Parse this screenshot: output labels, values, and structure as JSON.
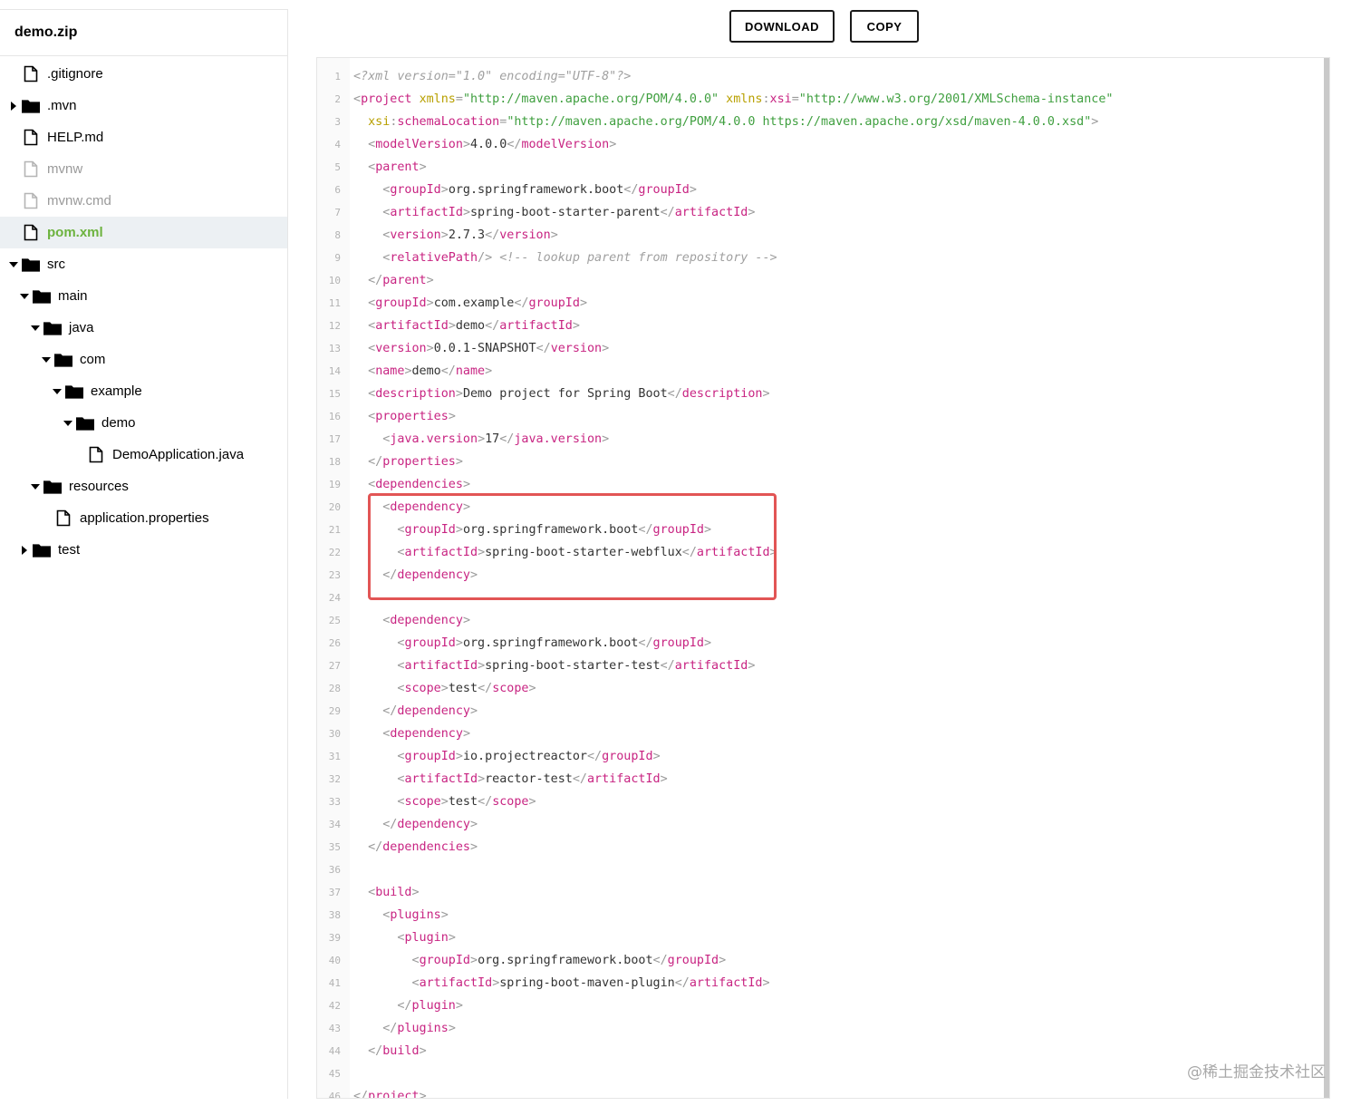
{
  "archive_name": "demo.zip",
  "buttons": {
    "download": "DOWNLOAD",
    "copy": "COPY"
  },
  "tree": [
    {
      "label": ".gitignore",
      "type": "file",
      "depth": 0,
      "caret": "none",
      "muted": false,
      "selected": false
    },
    {
      "label": ".mvn",
      "type": "folder",
      "depth": 0,
      "caret": "right",
      "muted": false,
      "selected": false
    },
    {
      "label": "HELP.md",
      "type": "file",
      "depth": 0,
      "caret": "none",
      "muted": false,
      "selected": false
    },
    {
      "label": "mvnw",
      "type": "file",
      "depth": 0,
      "caret": "none",
      "muted": true,
      "selected": false
    },
    {
      "label": "mvnw.cmd",
      "type": "file",
      "depth": 0,
      "caret": "none",
      "muted": true,
      "selected": false
    },
    {
      "label": "pom.xml",
      "type": "file",
      "depth": 0,
      "caret": "none",
      "muted": false,
      "selected": true
    },
    {
      "label": "src",
      "type": "folder",
      "depth": 0,
      "caret": "down",
      "muted": false,
      "selected": false
    },
    {
      "label": "main",
      "type": "folder",
      "depth": 1,
      "caret": "down",
      "muted": false,
      "selected": false
    },
    {
      "label": "java",
      "type": "folder",
      "depth": 2,
      "caret": "down",
      "muted": false,
      "selected": false
    },
    {
      "label": "com",
      "type": "folder",
      "depth": 3,
      "caret": "down",
      "muted": false,
      "selected": false
    },
    {
      "label": "example",
      "type": "folder",
      "depth": 4,
      "caret": "down",
      "muted": false,
      "selected": false
    },
    {
      "label": "demo",
      "type": "folder",
      "depth": 5,
      "caret": "down",
      "muted": false,
      "selected": false
    },
    {
      "label": "DemoApplication.java",
      "type": "file",
      "depth": 6,
      "caret": "none",
      "muted": false,
      "selected": false
    },
    {
      "label": "resources",
      "type": "folder",
      "depth": 2,
      "caret": "down",
      "muted": false,
      "selected": false
    },
    {
      "label": "application.properties",
      "type": "file",
      "depth": 3,
      "caret": "none",
      "muted": false,
      "selected": false
    },
    {
      "label": "test",
      "type": "folder",
      "depth": 1,
      "caret": "right",
      "muted": false,
      "selected": false
    }
  ],
  "code_lines": [
    [
      [
        "com",
        "<?xml version=\"1.0\" encoding=\"UTF-8\"?>"
      ]
    ],
    [
      [
        "punc",
        "<"
      ],
      [
        "tag",
        "project"
      ],
      [
        "text",
        " "
      ],
      [
        "attr",
        "xmlns"
      ],
      [
        "punc",
        "="
      ],
      [
        "str",
        "\"http://maven.apache.org/POM/4.0.0\""
      ],
      [
        "text",
        " "
      ],
      [
        "attr",
        "xmlns"
      ],
      [
        "punc",
        ":"
      ],
      [
        "tag",
        "xsi"
      ],
      [
        "punc",
        "="
      ],
      [
        "str",
        "\"http://www.w3.org/2001/XMLSchema-instance\""
      ]
    ],
    [
      [
        "text",
        "  "
      ],
      [
        "attr",
        "xsi"
      ],
      [
        "punc",
        ":"
      ],
      [
        "tag",
        "schemaLocation"
      ],
      [
        "punc",
        "="
      ],
      [
        "str",
        "\"http://maven.apache.org/POM/4.0.0 https://maven.apache.org/xsd/maven-4.0.0.xsd\""
      ],
      [
        "punc",
        ">"
      ]
    ],
    [
      [
        "text",
        "  "
      ],
      [
        "punc",
        "<"
      ],
      [
        "tag",
        "modelVersion"
      ],
      [
        "punc",
        ">"
      ],
      [
        "text",
        "4.0.0"
      ],
      [
        "punc",
        "</"
      ],
      [
        "tag",
        "modelVersion"
      ],
      [
        "punc",
        ">"
      ]
    ],
    [
      [
        "text",
        "  "
      ],
      [
        "punc",
        "<"
      ],
      [
        "tag",
        "parent"
      ],
      [
        "punc",
        ">"
      ]
    ],
    [
      [
        "text",
        "    "
      ],
      [
        "punc",
        "<"
      ],
      [
        "tag",
        "groupId"
      ],
      [
        "punc",
        ">"
      ],
      [
        "text",
        "org.springframework.boot"
      ],
      [
        "punc",
        "</"
      ],
      [
        "tag",
        "groupId"
      ],
      [
        "punc",
        ">"
      ]
    ],
    [
      [
        "text",
        "    "
      ],
      [
        "punc",
        "<"
      ],
      [
        "tag",
        "artifactId"
      ],
      [
        "punc",
        ">"
      ],
      [
        "text",
        "spring-boot-starter-parent"
      ],
      [
        "punc",
        "</"
      ],
      [
        "tag",
        "artifactId"
      ],
      [
        "punc",
        ">"
      ]
    ],
    [
      [
        "text",
        "    "
      ],
      [
        "punc",
        "<"
      ],
      [
        "tag",
        "version"
      ],
      [
        "punc",
        ">"
      ],
      [
        "text",
        "2.7.3"
      ],
      [
        "punc",
        "</"
      ],
      [
        "tag",
        "version"
      ],
      [
        "punc",
        ">"
      ]
    ],
    [
      [
        "text",
        "    "
      ],
      [
        "punc",
        "<"
      ],
      [
        "tag",
        "relativePath"
      ],
      [
        "punc",
        "/>"
      ],
      [
        "text",
        " "
      ],
      [
        "com",
        "<!-- lookup parent from repository -->"
      ]
    ],
    [
      [
        "text",
        "  "
      ],
      [
        "punc",
        "</"
      ],
      [
        "tag",
        "parent"
      ],
      [
        "punc",
        ">"
      ]
    ],
    [
      [
        "text",
        "  "
      ],
      [
        "punc",
        "<"
      ],
      [
        "tag",
        "groupId"
      ],
      [
        "punc",
        ">"
      ],
      [
        "text",
        "com.example"
      ],
      [
        "punc",
        "</"
      ],
      [
        "tag",
        "groupId"
      ],
      [
        "punc",
        ">"
      ]
    ],
    [
      [
        "text",
        "  "
      ],
      [
        "punc",
        "<"
      ],
      [
        "tag",
        "artifactId"
      ],
      [
        "punc",
        ">"
      ],
      [
        "text",
        "demo"
      ],
      [
        "punc",
        "</"
      ],
      [
        "tag",
        "artifactId"
      ],
      [
        "punc",
        ">"
      ]
    ],
    [
      [
        "text",
        "  "
      ],
      [
        "punc",
        "<"
      ],
      [
        "tag",
        "version"
      ],
      [
        "punc",
        ">"
      ],
      [
        "text",
        "0.0.1-SNAPSHOT"
      ],
      [
        "punc",
        "</"
      ],
      [
        "tag",
        "version"
      ],
      [
        "punc",
        ">"
      ]
    ],
    [
      [
        "text",
        "  "
      ],
      [
        "punc",
        "<"
      ],
      [
        "tag",
        "name"
      ],
      [
        "punc",
        ">"
      ],
      [
        "text",
        "demo"
      ],
      [
        "punc",
        "</"
      ],
      [
        "tag",
        "name"
      ],
      [
        "punc",
        ">"
      ]
    ],
    [
      [
        "text",
        "  "
      ],
      [
        "punc",
        "<"
      ],
      [
        "tag",
        "description"
      ],
      [
        "punc",
        ">"
      ],
      [
        "text",
        "Demo project for Spring Boot"
      ],
      [
        "punc",
        "</"
      ],
      [
        "tag",
        "description"
      ],
      [
        "punc",
        ">"
      ]
    ],
    [
      [
        "text",
        "  "
      ],
      [
        "punc",
        "<"
      ],
      [
        "tag",
        "properties"
      ],
      [
        "punc",
        ">"
      ]
    ],
    [
      [
        "text",
        "    "
      ],
      [
        "punc",
        "<"
      ],
      [
        "tag",
        "java.version"
      ],
      [
        "punc",
        ">"
      ],
      [
        "text",
        "17"
      ],
      [
        "punc",
        "</"
      ],
      [
        "tag",
        "java.version"
      ],
      [
        "punc",
        ">"
      ]
    ],
    [
      [
        "text",
        "  "
      ],
      [
        "punc",
        "</"
      ],
      [
        "tag",
        "properties"
      ],
      [
        "punc",
        ">"
      ]
    ],
    [
      [
        "text",
        "  "
      ],
      [
        "punc",
        "<"
      ],
      [
        "tag",
        "dependencies"
      ],
      [
        "punc",
        ">"
      ]
    ],
    [
      [
        "text",
        "    "
      ],
      [
        "punc",
        "<"
      ],
      [
        "tag",
        "dependency"
      ],
      [
        "punc",
        ">"
      ]
    ],
    [
      [
        "text",
        "      "
      ],
      [
        "punc",
        "<"
      ],
      [
        "tag",
        "groupId"
      ],
      [
        "punc",
        ">"
      ],
      [
        "text",
        "org.springframework.boot"
      ],
      [
        "punc",
        "</"
      ],
      [
        "tag",
        "groupId"
      ],
      [
        "punc",
        ">"
      ]
    ],
    [
      [
        "text",
        "      "
      ],
      [
        "punc",
        "<"
      ],
      [
        "tag",
        "artifactId"
      ],
      [
        "punc",
        ">"
      ],
      [
        "text",
        "spring-boot-starter-webflux"
      ],
      [
        "punc",
        "</"
      ],
      [
        "tag",
        "artifactId"
      ],
      [
        "punc",
        ">"
      ]
    ],
    [
      [
        "text",
        "    "
      ],
      [
        "punc",
        "</"
      ],
      [
        "tag",
        "dependency"
      ],
      [
        "punc",
        ">"
      ]
    ],
    [],
    [
      [
        "text",
        "    "
      ],
      [
        "punc",
        "<"
      ],
      [
        "tag",
        "dependency"
      ],
      [
        "punc",
        ">"
      ]
    ],
    [
      [
        "text",
        "      "
      ],
      [
        "punc",
        "<"
      ],
      [
        "tag",
        "groupId"
      ],
      [
        "punc",
        ">"
      ],
      [
        "text",
        "org.springframework.boot"
      ],
      [
        "punc",
        "</"
      ],
      [
        "tag",
        "groupId"
      ],
      [
        "punc",
        ">"
      ]
    ],
    [
      [
        "text",
        "      "
      ],
      [
        "punc",
        "<"
      ],
      [
        "tag",
        "artifactId"
      ],
      [
        "punc",
        ">"
      ],
      [
        "text",
        "spring-boot-starter-test"
      ],
      [
        "punc",
        "</"
      ],
      [
        "tag",
        "artifactId"
      ],
      [
        "punc",
        ">"
      ]
    ],
    [
      [
        "text",
        "      "
      ],
      [
        "punc",
        "<"
      ],
      [
        "tag",
        "scope"
      ],
      [
        "punc",
        ">"
      ],
      [
        "text",
        "test"
      ],
      [
        "punc",
        "</"
      ],
      [
        "tag",
        "scope"
      ],
      [
        "punc",
        ">"
      ]
    ],
    [
      [
        "text",
        "    "
      ],
      [
        "punc",
        "</"
      ],
      [
        "tag",
        "dependency"
      ],
      [
        "punc",
        ">"
      ]
    ],
    [
      [
        "text",
        "    "
      ],
      [
        "punc",
        "<"
      ],
      [
        "tag",
        "dependency"
      ],
      [
        "punc",
        ">"
      ]
    ],
    [
      [
        "text",
        "      "
      ],
      [
        "punc",
        "<"
      ],
      [
        "tag",
        "groupId"
      ],
      [
        "punc",
        ">"
      ],
      [
        "text",
        "io.projectreactor"
      ],
      [
        "punc",
        "</"
      ],
      [
        "tag",
        "groupId"
      ],
      [
        "punc",
        ">"
      ]
    ],
    [
      [
        "text",
        "      "
      ],
      [
        "punc",
        "<"
      ],
      [
        "tag",
        "artifactId"
      ],
      [
        "punc",
        ">"
      ],
      [
        "text",
        "reactor-test"
      ],
      [
        "punc",
        "</"
      ],
      [
        "tag",
        "artifactId"
      ],
      [
        "punc",
        ">"
      ]
    ],
    [
      [
        "text",
        "      "
      ],
      [
        "punc",
        "<"
      ],
      [
        "tag",
        "scope"
      ],
      [
        "punc",
        ">"
      ],
      [
        "text",
        "test"
      ],
      [
        "punc",
        "</"
      ],
      [
        "tag",
        "scope"
      ],
      [
        "punc",
        ">"
      ]
    ],
    [
      [
        "text",
        "    "
      ],
      [
        "punc",
        "</"
      ],
      [
        "tag",
        "dependency"
      ],
      [
        "punc",
        ">"
      ]
    ],
    [
      [
        "text",
        "  "
      ],
      [
        "punc",
        "</"
      ],
      [
        "tag",
        "dependencies"
      ],
      [
        "punc",
        ">"
      ]
    ],
    [],
    [
      [
        "text",
        "  "
      ],
      [
        "punc",
        "<"
      ],
      [
        "tag",
        "build"
      ],
      [
        "punc",
        ">"
      ]
    ],
    [
      [
        "text",
        "    "
      ],
      [
        "punc",
        "<"
      ],
      [
        "tag",
        "plugins"
      ],
      [
        "punc",
        ">"
      ]
    ],
    [
      [
        "text",
        "      "
      ],
      [
        "punc",
        "<"
      ],
      [
        "tag",
        "plugin"
      ],
      [
        "punc",
        ">"
      ]
    ],
    [
      [
        "text",
        "        "
      ],
      [
        "punc",
        "<"
      ],
      [
        "tag",
        "groupId"
      ],
      [
        "punc",
        ">"
      ],
      [
        "text",
        "org.springframework.boot"
      ],
      [
        "punc",
        "</"
      ],
      [
        "tag",
        "groupId"
      ],
      [
        "punc",
        ">"
      ]
    ],
    [
      [
        "text",
        "        "
      ],
      [
        "punc",
        "<"
      ],
      [
        "tag",
        "artifactId"
      ],
      [
        "punc",
        ">"
      ],
      [
        "text",
        "spring-boot-maven-plugin"
      ],
      [
        "punc",
        "</"
      ],
      [
        "tag",
        "artifactId"
      ],
      [
        "punc",
        ">"
      ]
    ],
    [
      [
        "text",
        "      "
      ],
      [
        "punc",
        "</"
      ],
      [
        "tag",
        "plugin"
      ],
      [
        "punc",
        ">"
      ]
    ],
    [
      [
        "text",
        "    "
      ],
      [
        "punc",
        "</"
      ],
      [
        "tag",
        "plugins"
      ],
      [
        "punc",
        ">"
      ]
    ],
    [
      [
        "text",
        "  "
      ],
      [
        "punc",
        "</"
      ],
      [
        "tag",
        "build"
      ],
      [
        "punc",
        ">"
      ]
    ],
    [],
    [
      [
        "punc",
        "</"
      ],
      [
        "tag",
        "project"
      ],
      [
        "punc",
        ">"
      ]
    ]
  ],
  "watermark": "@稀土掘金技术社区"
}
